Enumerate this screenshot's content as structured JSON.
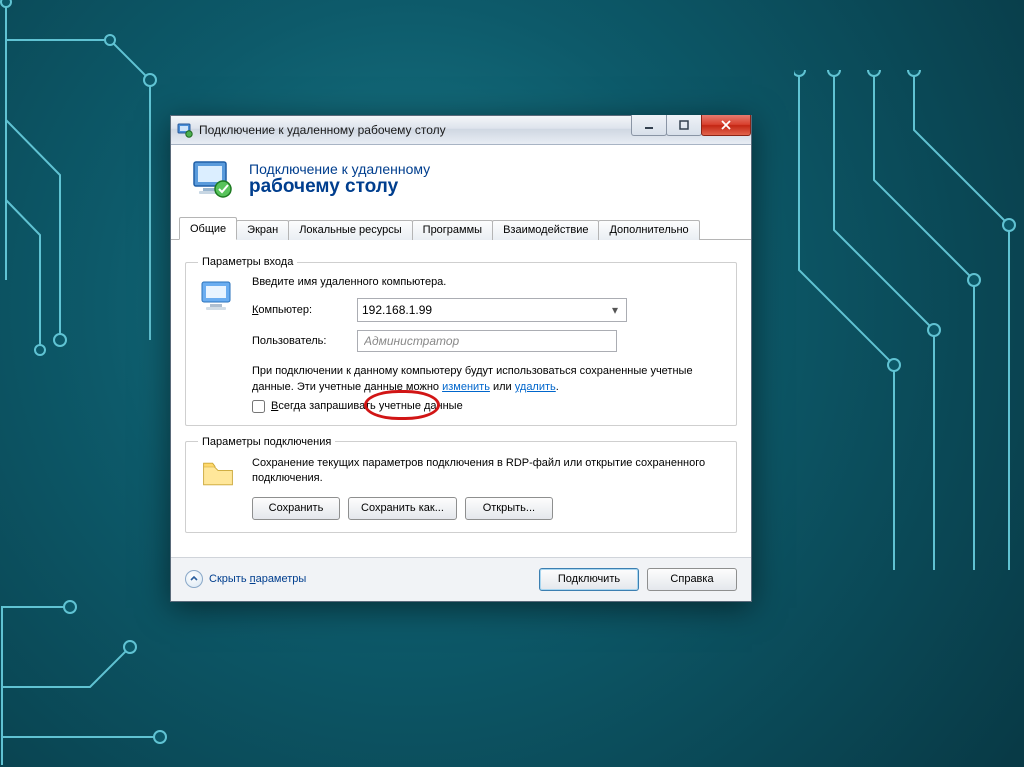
{
  "window": {
    "title": "Подключение к удаленному рабочему столу"
  },
  "header": {
    "line1": "Подключение к удаленному",
    "line2": "рабочему столу"
  },
  "tabs": {
    "general": "Общие",
    "display": "Экран",
    "local": "Локальные ресурсы",
    "programs": "Программы",
    "experience": "Взаимодействие",
    "advanced": "Дополнительно"
  },
  "login": {
    "legend": "Параметры входа",
    "instruction": "Введите имя удаленного компьютера.",
    "computer_label": "Компьютер:",
    "computer_label_ukey": "К",
    "computer_value": "192.168.1.99",
    "user_label": "Пользователь:",
    "user_placeholder": "Администратор",
    "note_pre": "При подключении к данному компьютеру будут использоваться сохраненные учетные данные. Эти учетные данные можно ",
    "link_edit": "изменить",
    "note_mid": " или ",
    "link_delete": "удалить",
    "note_post": ".",
    "always_ask": "Всегда запрашивать учетные данные",
    "always_ask_ukey": "В"
  },
  "connection": {
    "legend": "Параметры подключения",
    "description": "Сохранение текущих параметров подключения в RDP-файл или открытие сохраненного подключения.",
    "save": "Сохранить",
    "save_as": "Сохранить как...",
    "open": "Открыть..."
  },
  "footer": {
    "hide_options": "Скрыть параметры",
    "hide_options_ukey": "п",
    "connect": "Подключить",
    "help": "Справка"
  }
}
